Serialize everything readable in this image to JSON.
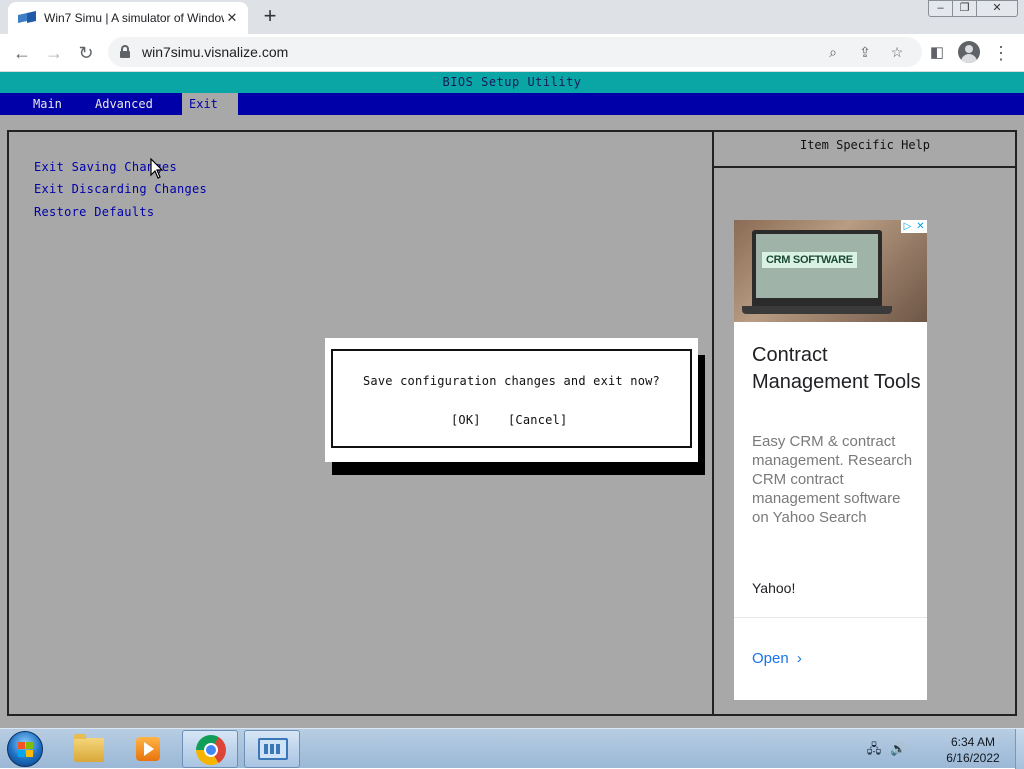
{
  "browser": {
    "tab_title": "Win7 Simu | A simulator of Windows 7",
    "url": "win7simu.visnalize.com",
    "new_tab_label": "+",
    "close_tab_glyph": "✕"
  },
  "bios": {
    "title": "BIOS Setup Utility",
    "menu": [
      {
        "label": "Main",
        "active": false
      },
      {
        "label": "Advanced",
        "active": false
      },
      {
        "label": "Exit",
        "active": true
      }
    ],
    "options": [
      "Exit Saving Changes",
      "Exit Discarding Changes",
      "Restore Defaults"
    ],
    "help_title": "Item Specific Help",
    "colors": {
      "menu_bar": "#0000a8",
      "title_bar": "#0aa6a6",
      "background": "#a8a8a8"
    }
  },
  "dialog": {
    "message": "Save configuration changes and exit now?",
    "ok_label": "[OK]",
    "cancel_label": "[Cancel]"
  },
  "ad": {
    "image_caption": "CRM SOFTWARE",
    "headline": "Contract Management Tools",
    "description": "Easy CRM & contract management. Research CRM contract management software on Yahoo Search",
    "advertiser": "Yahoo!",
    "cta": "Open",
    "cta_glyph": "›"
  },
  "taskbar": {
    "time": "6:34 AM",
    "date": "6/16/2022",
    "pinned": [
      "windows-explorer",
      "media-player",
      "chrome",
      "control-panel"
    ]
  }
}
